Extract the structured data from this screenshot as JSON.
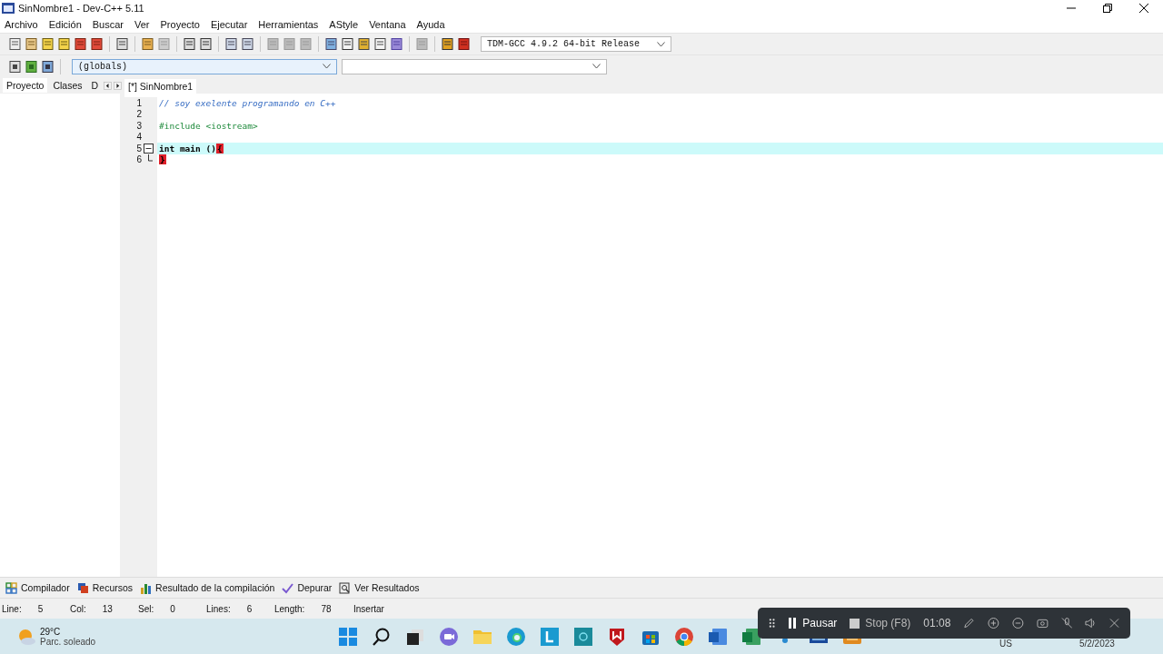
{
  "window": {
    "title": "SinNombre1 - Dev-C++ 5.11"
  },
  "menu": [
    "Archivo",
    "Edición",
    "Buscar",
    "Ver",
    "Proyecto",
    "Ejecutar",
    "Herramientas",
    "AStyle",
    "Ventana",
    "Ayuda"
  ],
  "compiler_select": {
    "value": "TDM-GCC 4.9.2 64-bit Release"
  },
  "scope_select": {
    "value": "(globals)"
  },
  "left_tabs": [
    {
      "label": "Proyecto",
      "selected": true
    },
    {
      "label": "Clases",
      "selected": false
    },
    {
      "label": "D",
      "selected": false
    }
  ],
  "editor_tabs": [
    {
      "label": "[*] SinNombre1",
      "selected": true
    }
  ],
  "code_lines": [
    {
      "number": "1",
      "kind": "comment",
      "text": "// soy exelente programando en C++",
      "current": false,
      "fold_open": false,
      "fold_end": false
    },
    {
      "number": "2",
      "kind": "blank",
      "current": false,
      "fold_open": false,
      "fold_end": false
    },
    {
      "number": "3",
      "kind": "preprocessor",
      "text": "#include <iostream>",
      "current": false,
      "fold_open": false,
      "fold_end": false
    },
    {
      "number": "4",
      "kind": "blank",
      "current": false,
      "fold_open": false,
      "fold_end": false
    },
    {
      "number": "5",
      "kind": "code",
      "text": "int main ()",
      "bracket": "{",
      "current": true,
      "fold_open": true,
      "fold_end": false
    },
    {
      "number": "6",
      "kind": "code",
      "bracket": "}",
      "current": false,
      "fold_open": false,
      "fold_end": true
    }
  ],
  "bottom_tabs": [
    {
      "label": "Compilador",
      "kind": "grid"
    },
    {
      "label": "Recursos",
      "kind": "resources"
    },
    {
      "label": "Resultado de la compilación",
      "kind": "chart"
    },
    {
      "label": "Depurar",
      "kind": "check"
    },
    {
      "label": "Ver Resultados",
      "kind": "find"
    }
  ],
  "status_bar": [
    {
      "label": "Line:",
      "value": "5"
    },
    {
      "label": "Col:",
      "value": "13"
    },
    {
      "label": "Sel:",
      "value": "0"
    },
    {
      "label": "Lines:",
      "value": "6"
    },
    {
      "label": "Length:",
      "value": "78"
    },
    {
      "label": "Insertar"
    }
  ],
  "weather": {
    "temperature": "29°C",
    "condition": "Parc. soleado"
  },
  "recorder": {
    "pause": "Pausar",
    "stop": "Stop (F8)",
    "time": "01:08"
  },
  "tray": {
    "language": "US",
    "date": "5/2/2023"
  }
}
